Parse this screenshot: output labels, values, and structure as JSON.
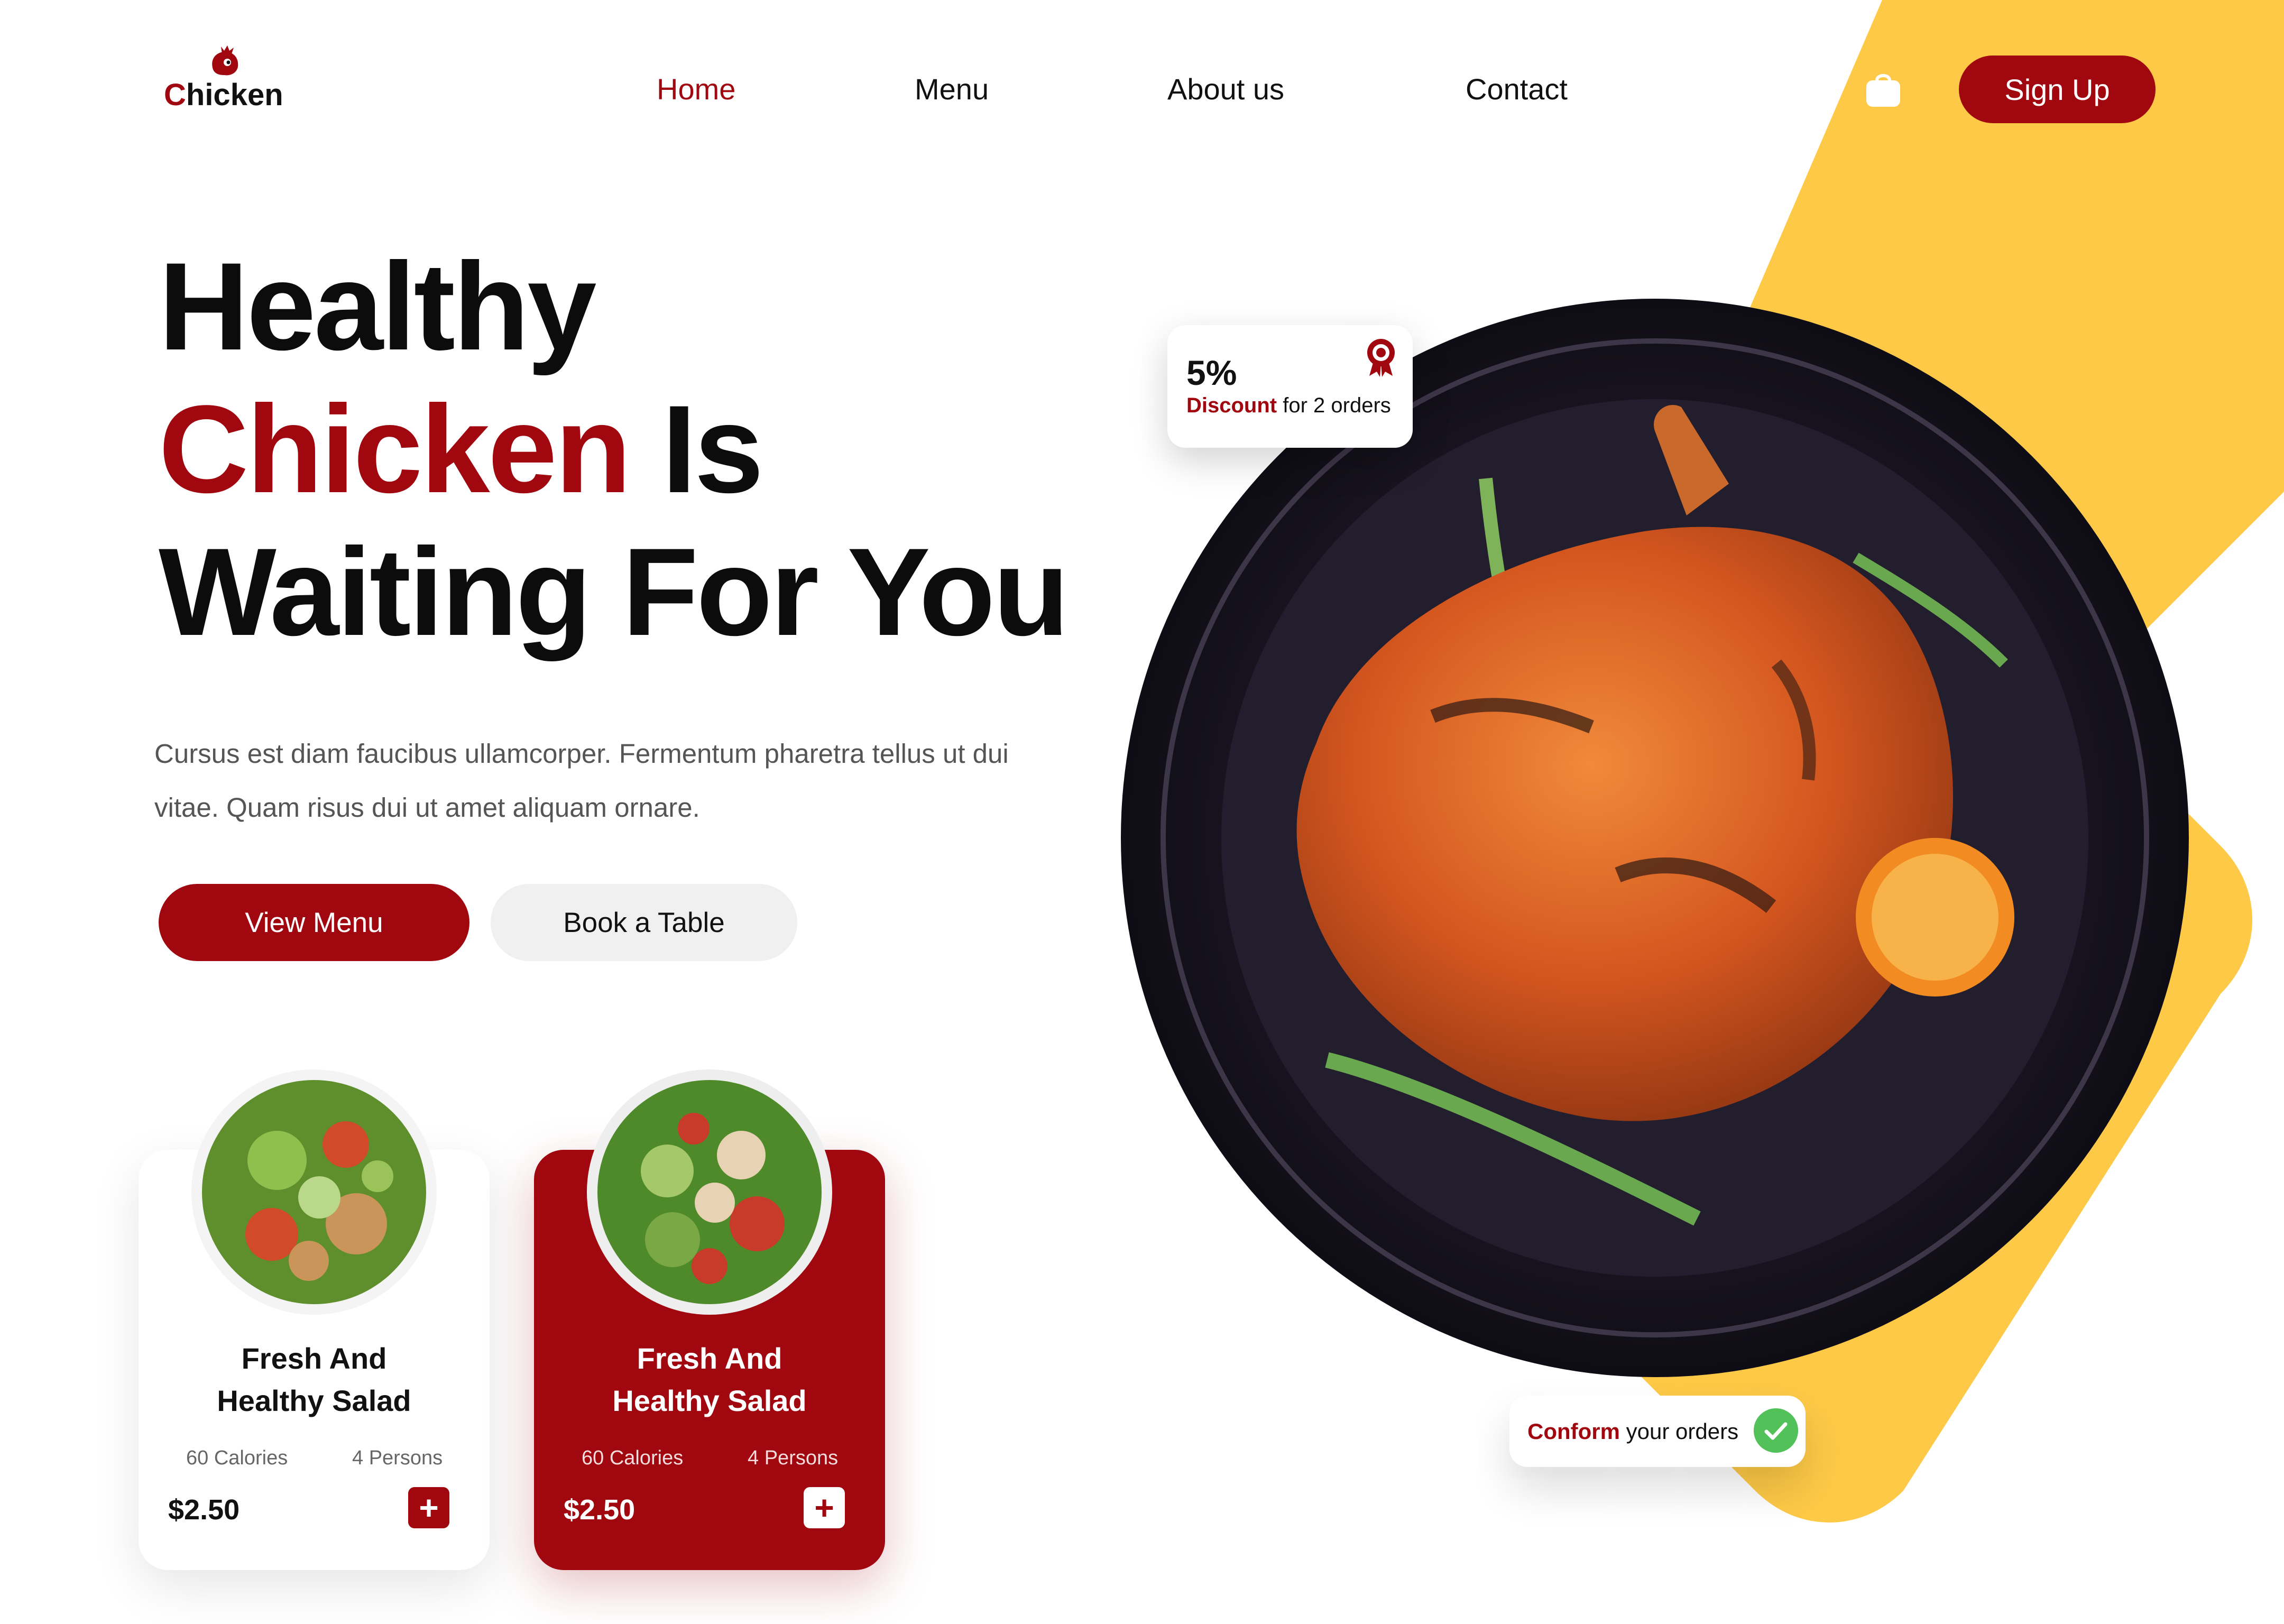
{
  "brand": {
    "logo_prefix": "C",
    "logo_rest": "hicken"
  },
  "nav": {
    "items": [
      {
        "label": "Home",
        "active": true
      },
      {
        "label": "Menu",
        "active": false
      },
      {
        "label": "About us",
        "active": false
      },
      {
        "label": "Contact",
        "active": false
      }
    ],
    "cart_icon": "shopping-bag-icon",
    "signup_label": "Sign Up"
  },
  "hero": {
    "line1": "Healthy",
    "line2_highlight": "Chicken",
    "line2_rest": " Is",
    "line3": "Waiting For You",
    "description": "Cursus est diam faucibus ullamcorper. Fermentum pharetra tellus ut dui vitae. Quam risus dui ut amet aliquam ornare.",
    "primary_button": "View Menu",
    "secondary_button": "Book a Table"
  },
  "cards": [
    {
      "title_line1": "Fresh And",
      "title_line2": "Healthy Salad",
      "calories": "60 Calories",
      "persons": "4 Persons",
      "price": "$2.50",
      "add_icon": "plus-icon",
      "style": "white"
    },
    {
      "title_line1": "Fresh And",
      "title_line2": "Healthy Salad",
      "calories": "60 Calories",
      "persons": "4 Persons",
      "price": "$2.50",
      "add_icon": "plus-icon",
      "style": "red"
    }
  ],
  "discount_badge": {
    "percent": "5%",
    "label_highlight": "Discount",
    "label_rest": " for 2 orders",
    "icon": "award-icon"
  },
  "confirm_badge": {
    "label_highlight": "Conform",
    "label_rest": " your orders",
    "icon": "check-icon"
  },
  "colors": {
    "brand_red": "#a0070f",
    "accent_yellow": "#fdc946",
    "text": "#111111",
    "check_green": "#52c15a"
  }
}
